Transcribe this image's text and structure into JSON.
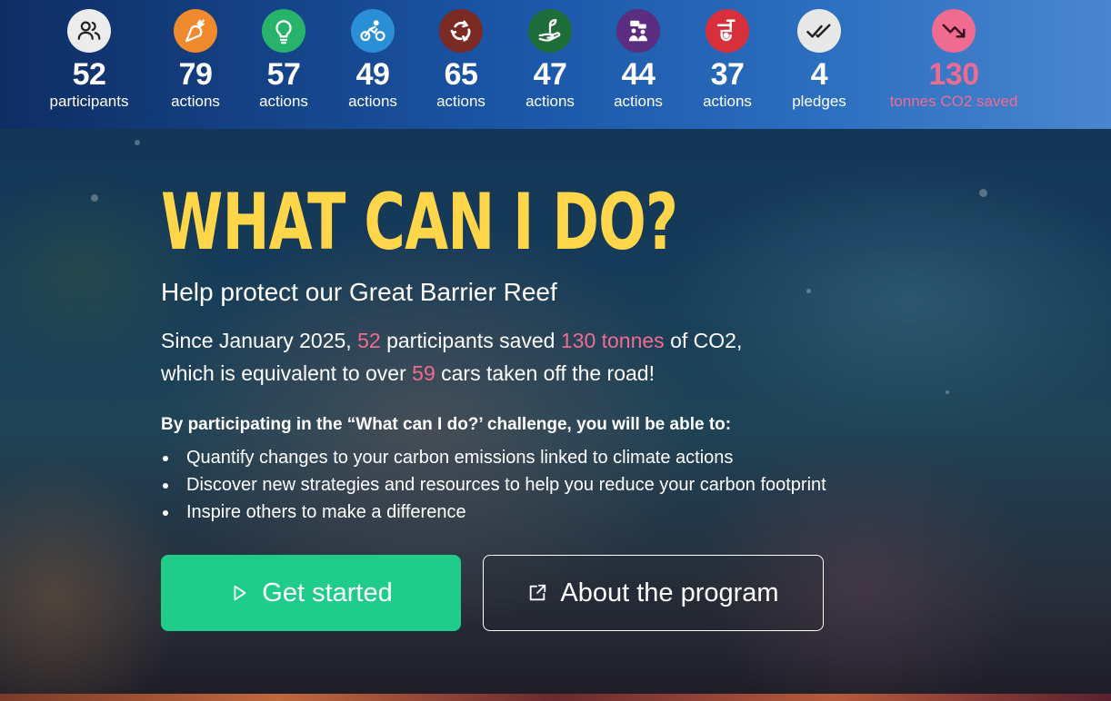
{
  "stats": [
    {
      "icon": "people-icon",
      "color": "#ececec",
      "value": "52",
      "label": "participants"
    },
    {
      "icon": "carrot-icon",
      "color": "#ef8a2e",
      "value": "79",
      "label": "actions"
    },
    {
      "icon": "lightbulb-icon",
      "color": "#28b36a",
      "value": "57",
      "label": "actions"
    },
    {
      "icon": "cyclist-icon",
      "color": "#2b8fd8",
      "value": "49",
      "label": "actions"
    },
    {
      "icon": "recycle-icon",
      "color": "#7b2b24",
      "value": "65",
      "label": "actions"
    },
    {
      "icon": "seedling-hand-icon",
      "color": "#1f6e3a",
      "value": "47",
      "label": "actions"
    },
    {
      "icon": "people-talking-icon",
      "color": "#5a2d80",
      "value": "44",
      "label": "actions"
    },
    {
      "icon": "tap-icon",
      "color": "#d8303a",
      "value": "37",
      "label": "actions"
    },
    {
      "icon": "double-check-icon",
      "color": "#e8e8e8",
      "value": "4",
      "label": "pledges"
    },
    {
      "icon": "trend-down-icon",
      "color": "#ef6b90",
      "value": "130",
      "label": "tonnes CO2 saved"
    }
  ],
  "hero": {
    "title": "WHAT CAN I DO?",
    "subtitle": "Help protect our Great Barrier Reef",
    "summary": {
      "part1": "Since January 2025, ",
      "participants": "52",
      "part2": " participants saved ",
      "tonnes": "130 tonnes",
      "part3": " of CO2,",
      "part4": "which is equivalent to over ",
      "cars": "59",
      "part5": " cars taken off the road!"
    },
    "benefits_heading": "By participating in the “What can I do?’ challenge, you will be able to:",
    "benefits": [
      "Quantify changes to your carbon emissions linked to climate actions",
      "Discover new strategies and resources to help you reduce your carbon footprint",
      "Inspire others to make a difference"
    ],
    "get_started_label": "Get started",
    "about_label": "About the program"
  },
  "colors": {
    "accent_yellow": "#ffd54a",
    "highlight_pink": "#ef6b90",
    "primary_green": "#1fcc8a"
  }
}
